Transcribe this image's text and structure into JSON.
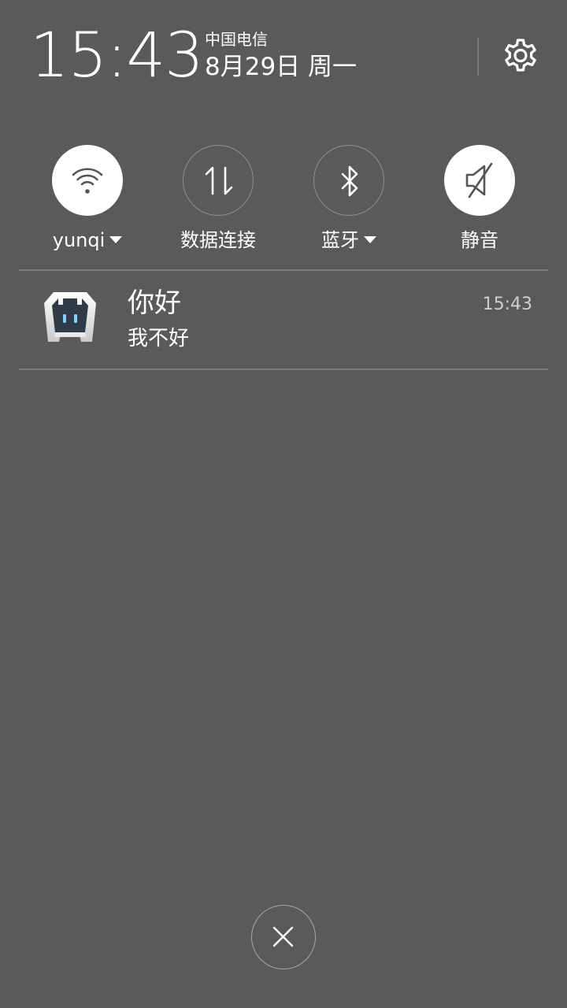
{
  "header": {
    "time": "15:43",
    "carrier": "中国电信",
    "date": "8月29日 周一",
    "settings_icon": "gear-icon"
  },
  "toggles": [
    {
      "label": "yunqi",
      "icon": "wifi-icon",
      "active": true,
      "has_dropdown": true
    },
    {
      "label": "数据连接",
      "icon": "data-arrows-icon",
      "active": false,
      "has_dropdown": false
    },
    {
      "label": "蓝牙",
      "icon": "bluetooth-icon",
      "active": false,
      "has_dropdown": true
    },
    {
      "label": "静音",
      "icon": "mute-icon",
      "active": true,
      "has_dropdown": false
    }
  ],
  "notification": {
    "app_icon": "cordova-app-icon",
    "title": "你好",
    "text": "我不好",
    "time": "15:43"
  },
  "dismiss": {
    "icon": "close-icon"
  },
  "colors": {
    "background": "#5a5a5a",
    "active_toggle": "#ffffff",
    "inactive_toggle_border": "#8e8e8e",
    "icon_dark": "#555555"
  }
}
